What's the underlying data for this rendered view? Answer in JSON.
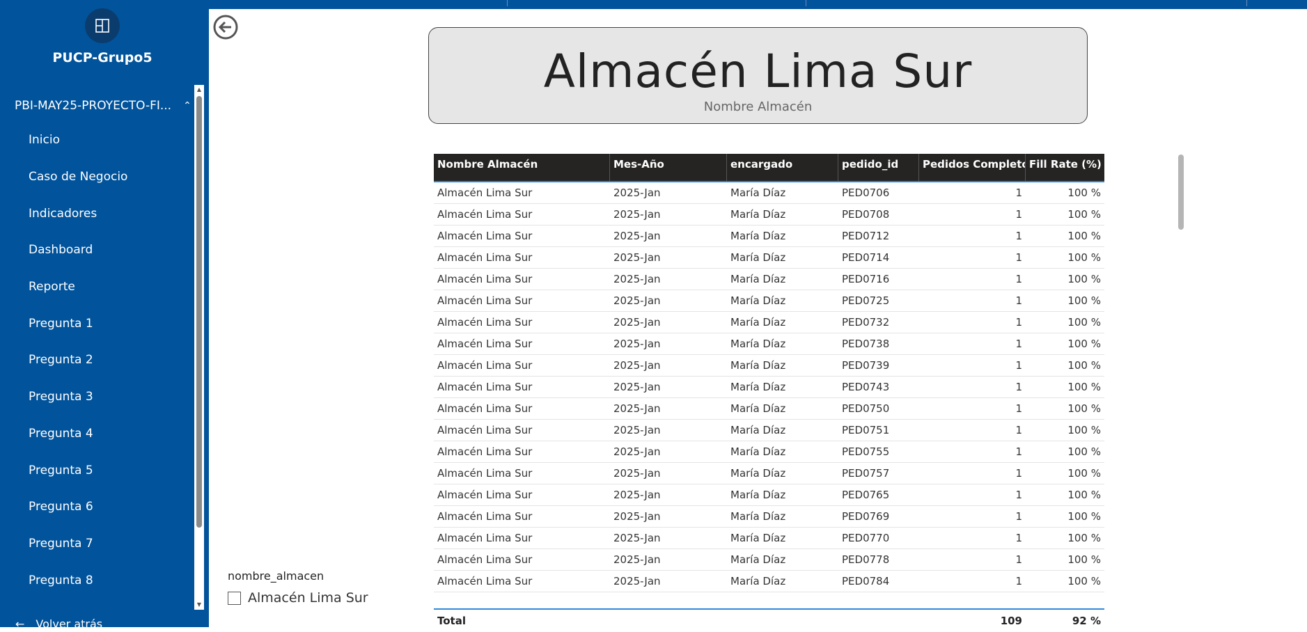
{
  "sidebar": {
    "workspace_name": "PUCP-Grupo5",
    "app_name": "PBI-MAY25-PROYECTO-FI...",
    "items": [
      {
        "label": "Inicio"
      },
      {
        "label": "Caso de Negocio"
      },
      {
        "label": "Indicadores"
      },
      {
        "label": "Dashboard"
      },
      {
        "label": "Reporte"
      },
      {
        "label": "Pregunta 1"
      },
      {
        "label": "Pregunta 2"
      },
      {
        "label": "Pregunta 3"
      },
      {
        "label": "Pregunta 4"
      },
      {
        "label": "Pregunta 5"
      },
      {
        "label": "Pregunta 6"
      },
      {
        "label": "Pregunta 7"
      },
      {
        "label": "Pregunta 8"
      }
    ],
    "back_label": "Volver atrás"
  },
  "card": {
    "value": "Almacén Lima Sur",
    "label": "Nombre Almacén"
  },
  "table": {
    "columns": [
      "Nombre Almacén",
      "Mes-Año",
      "encargado",
      "pedido_id",
      "Pedidos Completos",
      "Fill Rate (%)"
    ],
    "rows": [
      [
        "Almacén Lima Sur",
        "2025-Jan",
        "María Díaz",
        "PED0706",
        "1",
        "100 %"
      ],
      [
        "Almacén Lima Sur",
        "2025-Jan",
        "María Díaz",
        "PED0708",
        "1",
        "100 %"
      ],
      [
        "Almacén Lima Sur",
        "2025-Jan",
        "María Díaz",
        "PED0712",
        "1",
        "100 %"
      ],
      [
        "Almacén Lima Sur",
        "2025-Jan",
        "María Díaz",
        "PED0714",
        "1",
        "100 %"
      ],
      [
        "Almacén Lima Sur",
        "2025-Jan",
        "María Díaz",
        "PED0716",
        "1",
        "100 %"
      ],
      [
        "Almacén Lima Sur",
        "2025-Jan",
        "María Díaz",
        "PED0725",
        "1",
        "100 %"
      ],
      [
        "Almacén Lima Sur",
        "2025-Jan",
        "María Díaz",
        "PED0732",
        "1",
        "100 %"
      ],
      [
        "Almacén Lima Sur",
        "2025-Jan",
        "María Díaz",
        "PED0738",
        "1",
        "100 %"
      ],
      [
        "Almacén Lima Sur",
        "2025-Jan",
        "María Díaz",
        "PED0739",
        "1",
        "100 %"
      ],
      [
        "Almacén Lima Sur",
        "2025-Jan",
        "María Díaz",
        "PED0743",
        "1",
        "100 %"
      ],
      [
        "Almacén Lima Sur",
        "2025-Jan",
        "María Díaz",
        "PED0750",
        "1",
        "100 %"
      ],
      [
        "Almacén Lima Sur",
        "2025-Jan",
        "María Díaz",
        "PED0751",
        "1",
        "100 %"
      ],
      [
        "Almacén Lima Sur",
        "2025-Jan",
        "María Díaz",
        "PED0755",
        "1",
        "100 %"
      ],
      [
        "Almacén Lima Sur",
        "2025-Jan",
        "María Díaz",
        "PED0757",
        "1",
        "100 %"
      ],
      [
        "Almacén Lima Sur",
        "2025-Jan",
        "María Díaz",
        "PED0765",
        "1",
        "100 %"
      ],
      [
        "Almacén Lima Sur",
        "2025-Jan",
        "María Díaz",
        "PED0769",
        "1",
        "100 %"
      ],
      [
        "Almacén Lima Sur",
        "2025-Jan",
        "María Díaz",
        "PED0770",
        "1",
        "100 %"
      ],
      [
        "Almacén Lima Sur",
        "2025-Jan",
        "María Díaz",
        "PED0778",
        "1",
        "100 %"
      ],
      [
        "Almacén Lima Sur",
        "2025-Jan",
        "María Díaz",
        "PED0784",
        "1",
        "100 %"
      ]
    ],
    "total": {
      "label": "Total",
      "pedidos_completos": "109",
      "fill_rate": "92 %"
    }
  },
  "slicer": {
    "title": "nombre_almacen",
    "options": [
      "Almacén Lima Sur"
    ]
  },
  "colors": {
    "sidebar_bg": "#01539b",
    "header_bg": "#252423",
    "accent": "#2f8ad8"
  }
}
